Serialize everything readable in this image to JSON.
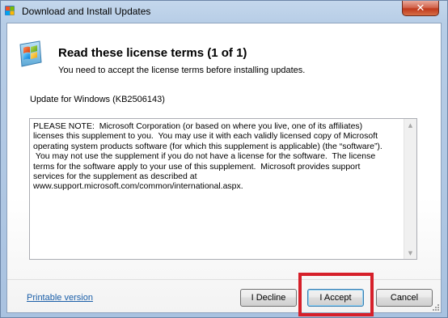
{
  "window": {
    "title": "Download and Install Updates",
    "close_glyph": "✕"
  },
  "header": {
    "title": "Read these license terms (1 of 1)",
    "subtitle": "You need to accept the license terms before installing updates."
  },
  "update": {
    "name": "Update for Windows (KB2506143)"
  },
  "license": {
    "text": "PLEASE NOTE:  Microsoft Corporation (or based on where you live, one of its affiliates)\nlicenses this supplement to you.  You may use it with each validly licensed copy of Microsoft\noperating system products software (for which this supplement is applicable) (the “software”).\n You may not use the supplement if you do not have a license for the software.  The license\nterms for the software apply to your use of this supplement.  Microsoft provides support\nservices for the supplement as described at\nwww.support.microsoft.com/common/international.aspx."
  },
  "footer": {
    "printable_link": "Printable version",
    "decline_label": "I Decline",
    "accept_label": "I Accept",
    "cancel_label": "Cancel"
  },
  "icons": {
    "app": "windows-update-icon",
    "header": "windows-flag-icon"
  },
  "colors": {
    "highlight": "#d6202a",
    "link": "#1a5ea8",
    "close_button": "#c0391c"
  }
}
